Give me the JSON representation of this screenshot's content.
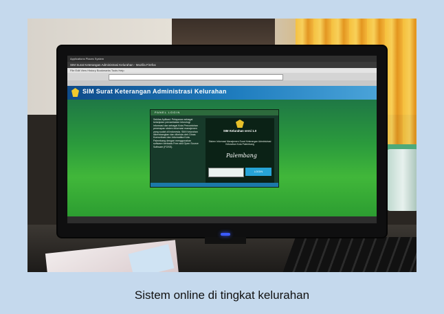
{
  "caption": "Sistem online di tingkat kelurahan",
  "screen": {
    "os_bar": "Applications  Places  System",
    "window_title": "SIM Surat Keterangan Administrasi Kelurahan - Mozilla Firefox",
    "menu": "File  Edit  View  History  Bookmarks  Tools  Help",
    "page_header_title": "SIM Surat Keterangan Administrasi Kelurahan",
    "login_panel_heading": "PANEL LOGIN",
    "login_left_text": "Sekilas Aplikasi: Pelayanan sebagai kelanjutan pemanfaatan teknologi informasi dan sebagai Kota Percontohan penerapan sistem informasi manajemen yang sudah di Indonesia. SIM Kelurahan dikembangkan dan dikelola oleh Dinas Komunikasi dan Informatika Kota Palembang dengan menggunakan software berbasis Free and Open Source Software (FOSS).",
    "login_app_title": "SIM Kelurahan versi 1.0",
    "login_description": "Sistem Informasi Manajemen Surat Keterangan Administrasi Kelurahan Kota Palembang",
    "login_sign": "Palembang",
    "login_button": "LOGIN",
    "brand_color": "#1f7dbf",
    "accent_color": "#2b9b3c"
  }
}
